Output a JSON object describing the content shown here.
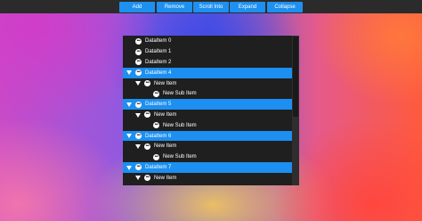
{
  "toolbar": {
    "add_label": "Add",
    "remove_label": "Remove",
    "scroll_into_label": "Scroll Into",
    "expand_label": "Expand",
    "collapse_label": "Collapse"
  },
  "tree": {
    "rows": [
      {
        "label": "DataItem 0",
        "level": 0,
        "selected": false,
        "expanded": false
      },
      {
        "label": "DataItem 1",
        "level": 0,
        "selected": false,
        "expanded": false
      },
      {
        "label": "DataItem 2",
        "level": 0,
        "selected": false,
        "expanded": false
      },
      {
        "label": "DataItem 4",
        "level": 0,
        "selected": true,
        "expanded": true
      },
      {
        "label": "New Item",
        "level": 1,
        "selected": false,
        "expanded": true
      },
      {
        "label": "New Sub Item",
        "level": 2,
        "selected": false,
        "expanded": false
      },
      {
        "label": "DataItem 5",
        "level": 0,
        "selected": true,
        "expanded": true
      },
      {
        "label": "New Item",
        "level": 1,
        "selected": false,
        "expanded": true
      },
      {
        "label": "New Sub Item",
        "level": 2,
        "selected": false,
        "expanded": false
      },
      {
        "label": "DataItem 6",
        "level": 0,
        "selected": true,
        "expanded": true
      },
      {
        "label": "New Item",
        "level": 1,
        "selected": false,
        "expanded": true
      },
      {
        "label": "New Sub Item",
        "level": 2,
        "selected": false,
        "expanded": false
      },
      {
        "label": "DataItem 7",
        "level": 0,
        "selected": true,
        "expanded": true
      },
      {
        "label": "New Item",
        "level": 1,
        "selected": false,
        "expanded": true
      }
    ]
  },
  "colors": {
    "accent": "#1c8ff0",
    "panel": "#1f1f1f",
    "toolbar": "#2b2b2b"
  },
  "icons": {
    "item": "more-dots-icon",
    "expanded": "expand-triangle-icon"
  }
}
